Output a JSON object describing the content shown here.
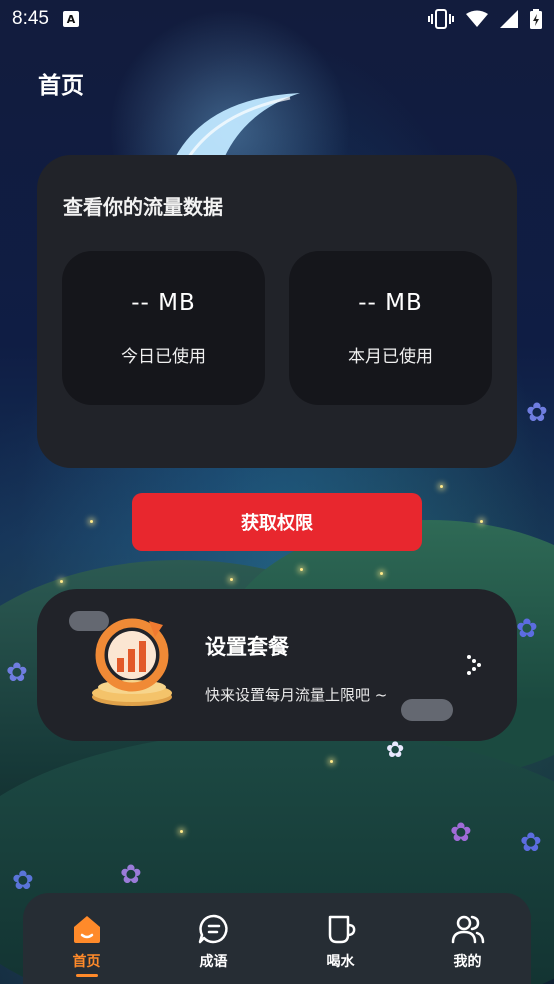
{
  "status_bar": {
    "time": "8:45",
    "notification_glyph": "A"
  },
  "page": {
    "title": "首页"
  },
  "stats": {
    "title": "查看你的流量数据",
    "today": {
      "value": "-- MB",
      "label": "今日已使用"
    },
    "month": {
      "value": "-- MB",
      "label": "本月已使用"
    }
  },
  "permission_button": {
    "label": "获取权限"
  },
  "plan": {
    "title": "设置套餐",
    "subtitle": "快来设置每月流量上限吧 ~"
  },
  "nav": {
    "items": [
      {
        "label": "首页",
        "icon": "home-icon",
        "active": true
      },
      {
        "label": "成语",
        "icon": "chat-bubble-icon",
        "active": false
      },
      {
        "label": "喝水",
        "icon": "cup-icon",
        "active": false
      },
      {
        "label": "我的",
        "icon": "users-icon",
        "active": false
      }
    ]
  },
  "colors": {
    "accent": "#ff8a2a",
    "button": "#e8272e",
    "card": "#212329"
  }
}
